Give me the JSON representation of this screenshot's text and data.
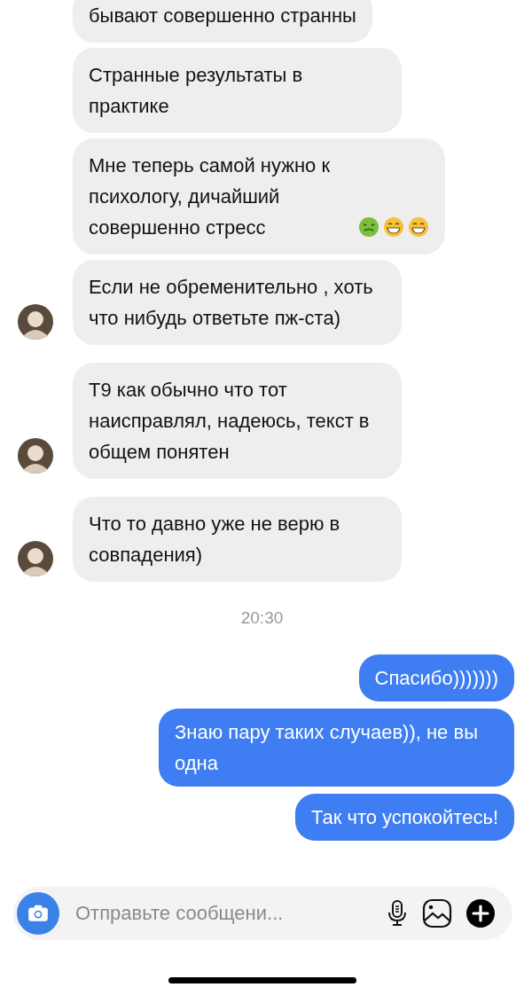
{
  "messages": [
    {
      "kind": "incoming",
      "text": "бывают совершенно странны",
      "avatar": false
    },
    {
      "kind": "incoming",
      "text": "Странные результаты  в практике",
      "avatar": false
    },
    {
      "kind": "incoming",
      "text": "Мне теперь самой нужно к психологу, дичайший совершенно стресс",
      "avatar": false,
      "emoji": [
        {
          "kind": "sick"
        },
        {
          "kind": "grin"
        },
        {
          "kind": "grin"
        }
      ]
    },
    {
      "kind": "incoming",
      "text": "Если не обременительно , хоть что нибудь  ответьте пж-ста)",
      "avatar": true
    },
    {
      "kind": "incoming",
      "text": "Т9 как обычно что тот наисправлял, надеюсь, текст в общем понятен",
      "avatar": true
    },
    {
      "kind": "incoming",
      "text": "Что то давно уже не верю в совпадения)",
      "avatar": true
    },
    {
      "kind": "time",
      "text": "20:30"
    },
    {
      "kind": "outgoing",
      "text": "Спасибо)))))))"
    },
    {
      "kind": "outgoing",
      "text": "Знаю пару таких случаев)), не вы одна"
    },
    {
      "kind": "outgoing",
      "text": "Так что успокойтесь!"
    }
  ],
  "composer": {
    "placeholder": "Отправьте сообщени..."
  }
}
